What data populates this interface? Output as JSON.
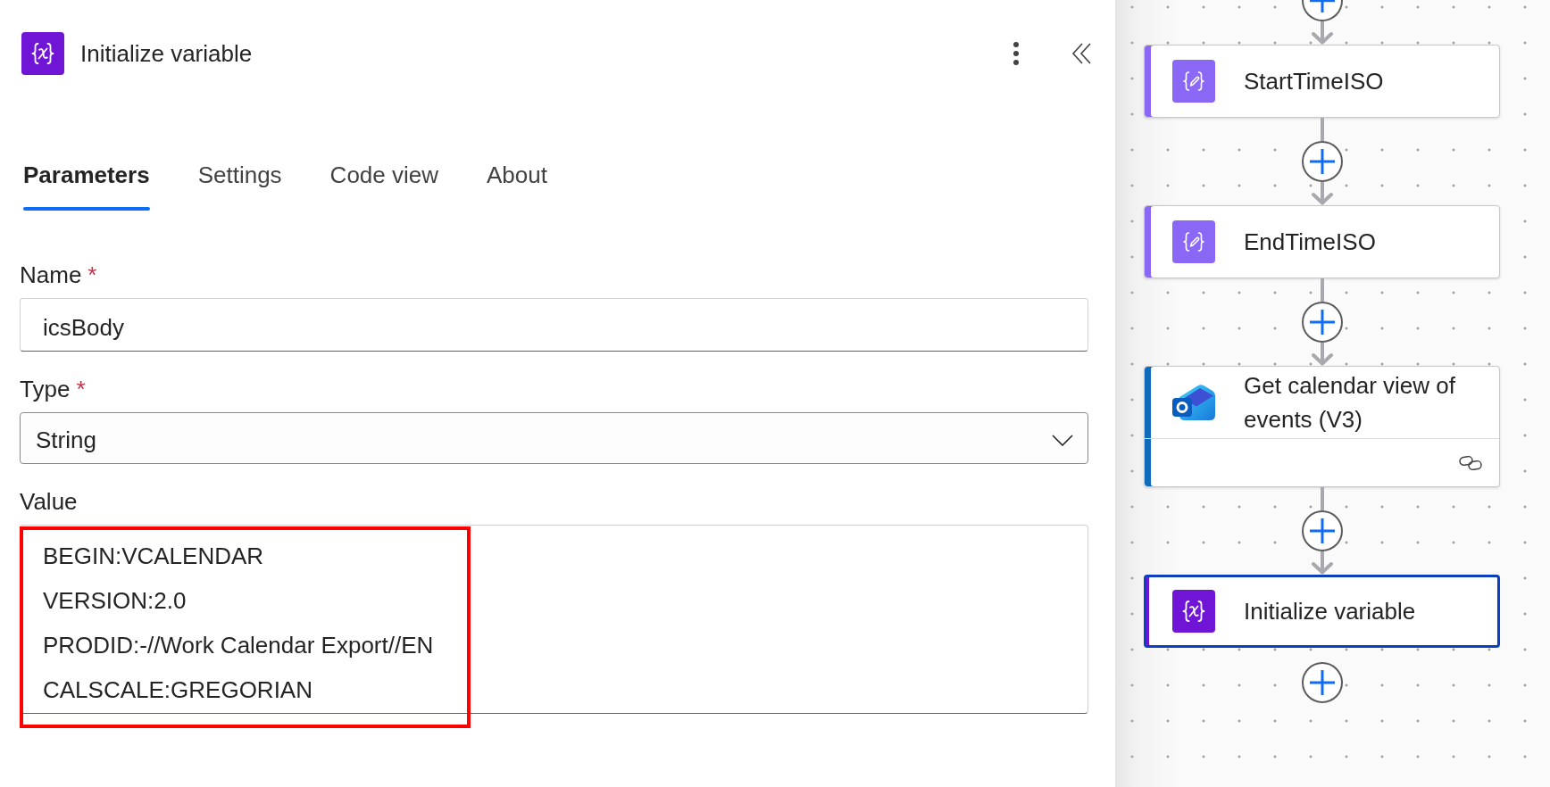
{
  "header": {
    "kind": "variable",
    "title": "Initialize variable"
  },
  "tabs": [
    {
      "label": "Parameters",
      "selected": true
    },
    {
      "label": "Settings",
      "selected": false
    },
    {
      "label": "Code view",
      "selected": false
    },
    {
      "label": "About",
      "selected": false
    }
  ],
  "fields": [
    {
      "kind": "text",
      "label": "Name",
      "required_mark": "*",
      "value": "icsBody"
    },
    {
      "kind": "dropdown",
      "label": "Type",
      "required_mark": "*",
      "value": "String"
    },
    {
      "kind": "multiline",
      "label": "Value",
      "lines": [
        "BEGIN:VCALENDAR",
        "VERSION:2.0",
        "PRODID:-//Work Calendar Export//EN",
        "CALSCALE:GREGORIAN"
      ],
      "highlighted": true
    }
  ],
  "flow": {
    "steps": [
      {
        "kind": "compose",
        "title": "StartTimeISO",
        "selected": false,
        "linked": false
      },
      {
        "kind": "compose",
        "title": "EndTimeISO",
        "selected": false,
        "linked": false
      },
      {
        "kind": "outlook",
        "title": "Get calendar view of events (V3)",
        "selected": false,
        "linked": true
      },
      {
        "kind": "variable",
        "title": "Initialize variable",
        "selected": true,
        "linked": false
      }
    ]
  }
}
